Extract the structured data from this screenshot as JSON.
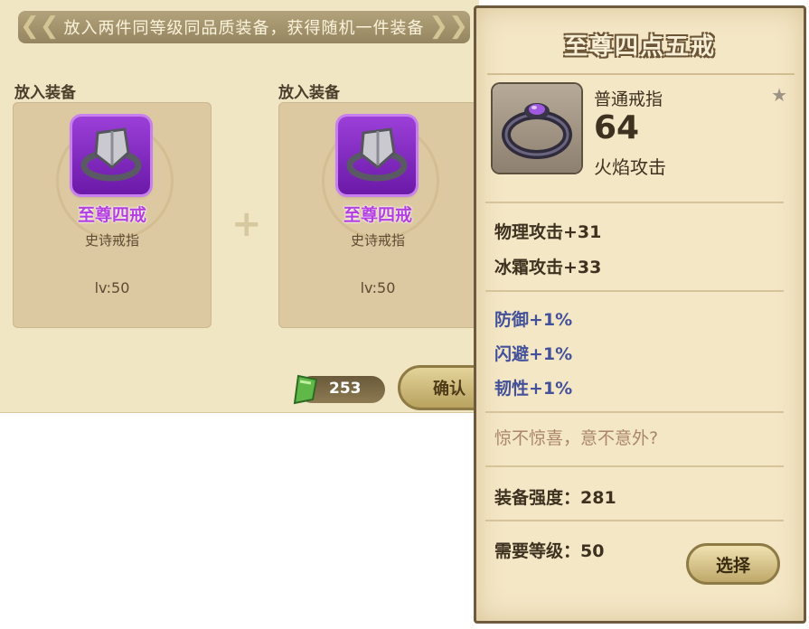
{
  "merge": {
    "banner_text": "放入两件同等级同品质装备，获得随机一件装备",
    "banner_arrow_left": "❮❮",
    "banner_arrow_right": "❯❯",
    "slots": [
      {
        "label": "放入装备",
        "item_name": "至尊四戒",
        "item_type": "史诗戒指",
        "level": "lv:50"
      },
      {
        "label": "放入装备",
        "item_name": "至尊四戒",
        "item_type": "史诗戒指",
        "level": "lv:50"
      }
    ],
    "plus_symbol": "+",
    "gem_count": "253",
    "confirm_label": "确认"
  },
  "detail": {
    "title": "至尊四点五戒",
    "item_type": "普通戒指",
    "power": "64",
    "attribute": "火焰攻击",
    "star_symbol": "★",
    "base_stats": [
      "物理攻击+31",
      "冰霜攻击+33"
    ],
    "bonus_stats": [
      "防御+1%",
      "闪避+1%",
      "韧性+1%"
    ],
    "flavor_text": "惊不惊喜，意不意外?",
    "strength": "装备强度：281",
    "required_level": "需要等级：50",
    "select_label": "选择"
  },
  "colors": {
    "panel_bg": "#f1e6c3",
    "epic_purple": "#b43fe0",
    "bonus_blue": "#43509a",
    "flavor_brown": "#a98667"
  },
  "icons": {
    "epic_ring": "shield-ring-icon",
    "common_ring": "purple-gem-ring-icon",
    "gem": "green-gem-icon",
    "favorite": "star-icon"
  }
}
